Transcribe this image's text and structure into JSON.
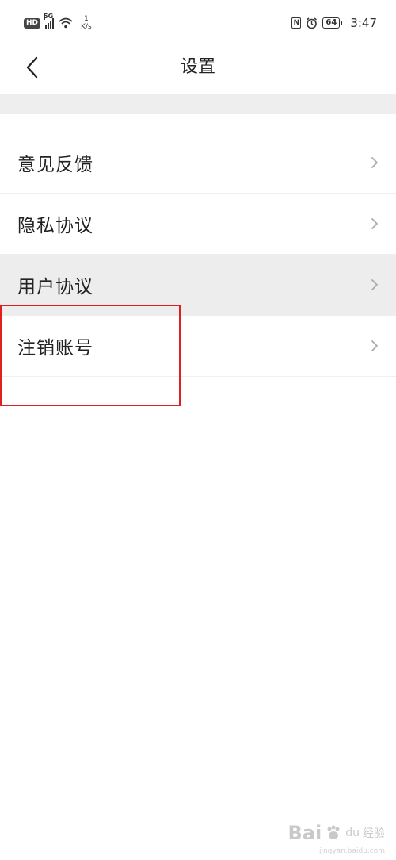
{
  "status_bar": {
    "hd": "HD",
    "network": "5G",
    "speed_value": "1",
    "speed_unit": "K/s",
    "battery": "64",
    "time": "3:47",
    "icons": [
      "hd-icon",
      "signal-icon",
      "wifi-icon",
      "nfc-icon",
      "alarm-icon",
      "battery-icon"
    ]
  },
  "header": {
    "title": "设置",
    "back_icon": "chevron-left-icon"
  },
  "settings": {
    "items": [
      {
        "label": "意见反馈"
      },
      {
        "label": "隐私协议"
      },
      {
        "label": "用户协议"
      },
      {
        "label": "注销账号"
      }
    ]
  },
  "annotation": {
    "highlight_color": "#e02020",
    "highlighted_item": "注销账号"
  },
  "watermark": {
    "brand": "Bai",
    "paw": "du",
    "suffix": "经验",
    "url": "jingyan.baidu.com"
  }
}
